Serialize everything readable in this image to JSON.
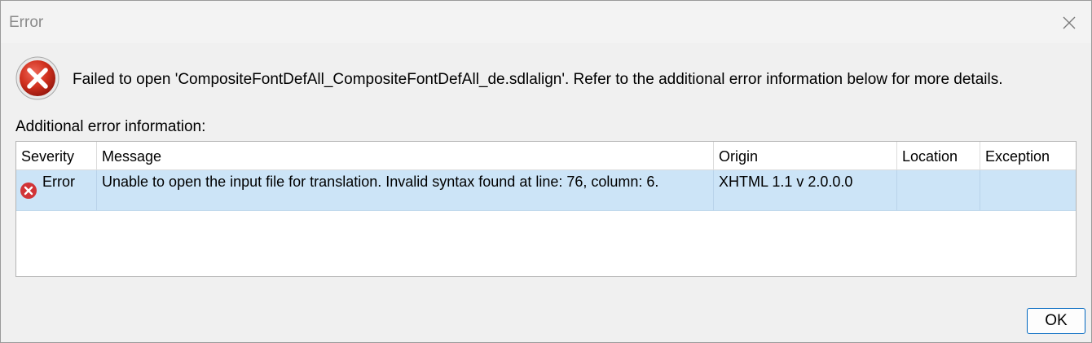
{
  "window": {
    "title": "Error"
  },
  "message": {
    "text": "Failed to open 'CompositeFontDefAll_CompositeFontDefAll_de.sdlalign'. Refer to the additional error information below for more details.",
    "icon": "error-icon"
  },
  "details": {
    "label": "Additional error information:",
    "columns": [
      "Severity",
      "Message",
      "Origin",
      "Location",
      "Exception"
    ],
    "rows": [
      {
        "severity": "Error",
        "message": "Unable to open the input file for translation. Invalid syntax found at line: 76, column: 6.",
        "origin": "XHTML 1.1 v 2.0.0.0",
        "location": "",
        "exception": ""
      }
    ]
  },
  "buttons": {
    "ok_label": "OK"
  },
  "colors": {
    "error_red": "#c42b1c",
    "selection": "#cce4f7",
    "accent": "#0067c0"
  }
}
